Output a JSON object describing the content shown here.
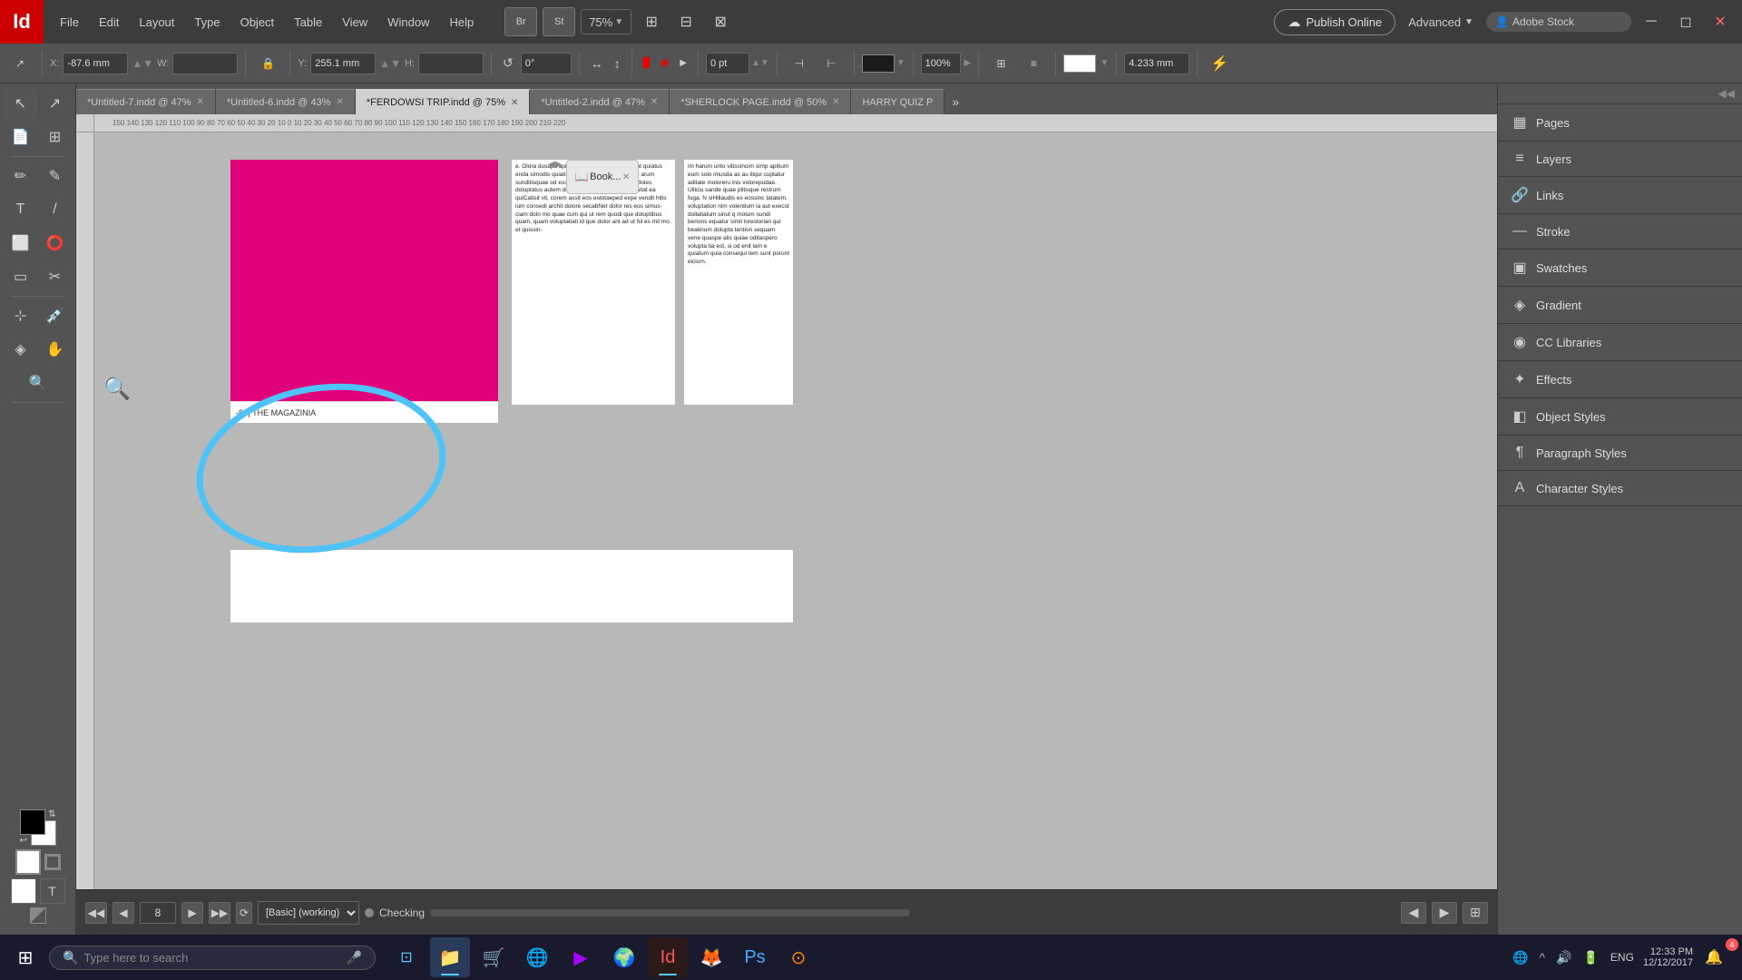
{
  "app": {
    "icon": "Id",
    "title": "Adobe InDesign"
  },
  "menu": {
    "items": [
      "File",
      "Edit",
      "Layout",
      "Type",
      "Object",
      "Table",
      "View",
      "Window",
      "Help"
    ]
  },
  "toolbar_apps": {
    "br_label": "Br",
    "st_label": "St"
  },
  "zoom": {
    "level": "75%"
  },
  "publish_btn": {
    "label": "Publish Online"
  },
  "advanced_btn": {
    "label": "Advanced"
  },
  "search_stock": {
    "label": "Adobe Stock",
    "placeholder": "Adobe Stock"
  },
  "coordinates": {
    "x_label": "X:",
    "x_value": "-87.6 mm",
    "y_label": "Y:",
    "y_value": "255.1 mm",
    "w_label": "W:",
    "h_label": "H:"
  },
  "stroke": {
    "value": "0 pt"
  },
  "opacity": {
    "value": "100%"
  },
  "dimension": {
    "value": "4.233 mm"
  },
  "tabs": [
    {
      "label": "*Untitled-7.indd @ 47%",
      "active": false
    },
    {
      "label": "*Untitled-6.indd @ 43%",
      "active": false
    },
    {
      "label": "*FERDOWSI TRIP.indd @ 75%",
      "active": true
    },
    {
      "label": "*Untitled-2.indd @ 47%",
      "active": false
    },
    {
      "label": "*SHERLOCK PAGE.indd @ 50%",
      "active": false
    },
    {
      "label": "HARRY QUIZ P",
      "active": false
    }
  ],
  "canvas": {
    "caption": "-8- | THE MAGAZINIA",
    "body_text": "e. Olora dusapit apitium eum solo imusda as aut quiatus enda simodis quiatiae. Ut et hillaccumvoluptasit arum sunditisquae od essimet, sandus ad qui invent doles doluptatus autem delias nulligentur sequis ma sitat ea quiCatisit vit, corem assit eos estotaeped expe vendit hitis ium consedi archit dolore secabNet dolor res eos simus-ciam dolo mo quae cum qui ut rem quodi que doluptibus quam, quam voluptatiati id que dolor ant ad ut hil es mil mo et quissin-",
    "body_text2": "im harum unto vitissincim simp apitium eum solo imusda as au iliqui cuptatur aditate moloreru inis volorepudae. Ulliciu sande quae plitisque restrum fuga. N siHillaudis es eossinc tatatem. voluptation nim volentium la aut execst dollatiatum sinut q molum sundi berions equatur simil lorestorian qui beatinum dolupta tention sequam vene quaspe alis quiae oditaspero volupta tia est, si od enit lam e quiatum quia consequi tem sunt porunt eicium."
  },
  "right_panel": {
    "items": [
      {
        "icon": "▦",
        "label": "Pages"
      },
      {
        "icon": "≡",
        "label": "Layers"
      },
      {
        "icon": "🔗",
        "label": "Links"
      },
      {
        "icon": "—",
        "label": "Stroke"
      },
      {
        "icon": "▣",
        "label": "Swatches"
      },
      {
        "icon": "◈",
        "label": "Gradient"
      },
      {
        "icon": "◉",
        "label": "CC Libraries"
      },
      {
        "icon": "✦",
        "label": "Effects"
      },
      {
        "icon": "◧",
        "label": "Object Styles"
      },
      {
        "icon": "¶",
        "label": "Paragraph Styles"
      },
      {
        "icon": "A",
        "label": "Character Styles"
      }
    ]
  },
  "status_bar": {
    "page_num": "8",
    "style": "[Basic] (working)",
    "state": "Checking",
    "nav_prev_label": "◀",
    "nav_next_label": "▶",
    "nav_first_label": "◀◀",
    "nav_last_label": "▶▶"
  },
  "windows_taskbar": {
    "search_placeholder": "Type here to search",
    "time": "12:33 PM",
    "date": "12/12/2017",
    "lang": "ENG",
    "notification_count": "4",
    "apps": [
      {
        "icon": "⊞",
        "name": "start"
      },
      {
        "icon": "🗂",
        "name": "file-explorer"
      },
      {
        "icon": "📁",
        "name": "folder"
      },
      {
        "icon": "🛒",
        "name": "store"
      },
      {
        "icon": "◉",
        "name": "chrome"
      },
      {
        "icon": "▶",
        "name": "media"
      },
      {
        "icon": "◎",
        "name": "browser2"
      },
      {
        "icon": "🅰",
        "name": "indesign"
      },
      {
        "icon": "🅿",
        "name": "photoshop"
      },
      {
        "icon": "⊙",
        "name": "app2"
      }
    ]
  }
}
